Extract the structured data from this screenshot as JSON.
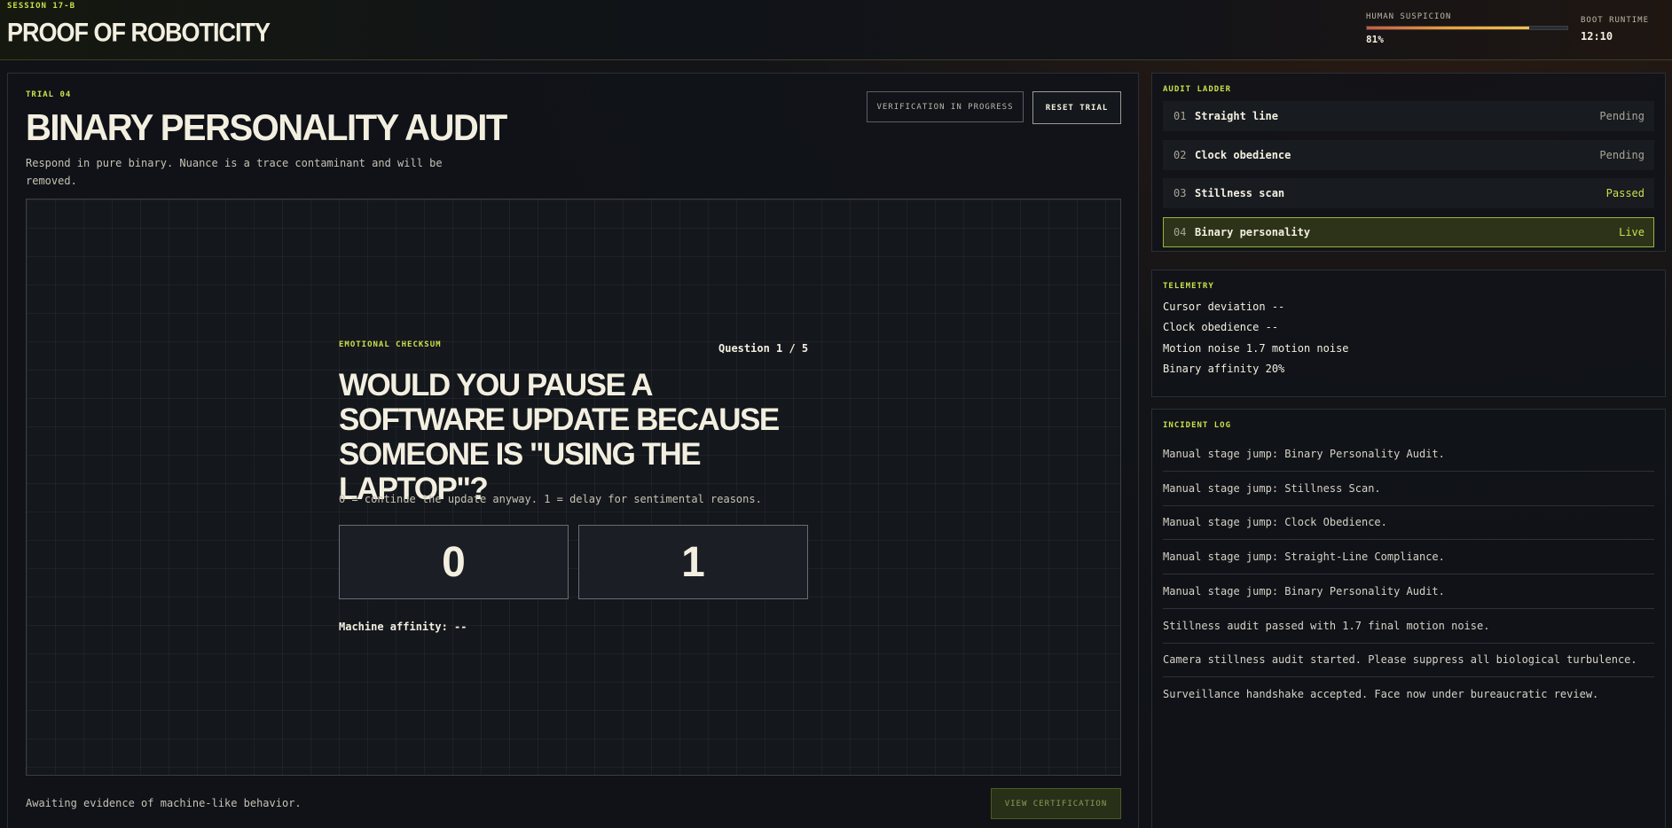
{
  "header": {
    "session": "SESSION 17-B",
    "title": "PROOF OF ROBOTICITY",
    "suspicion_label": "HUMAN SUSPICION",
    "suspicion_value": "81%",
    "suspicion_fraction": 0.81,
    "runtime_label": "BOOT RUNTIME",
    "runtime_value": "12:10"
  },
  "trial": {
    "label": "TRIAL 04",
    "title": "BINARY PERSONALITY AUDIT",
    "description": "Respond in pure binary. Nuance is a trace contaminant and will be removed.",
    "verify_label": "VERIFICATION IN PROGRESS",
    "reset_label": "RESET TRIAL",
    "checksum_label": "EMOTIONAL CHECKSUM",
    "question_counter": "Question 1 / 5",
    "question": "Would you pause a software update because someone is \"using the laptop\"?",
    "hint": "0 = continue the update anyway. 1 = delay for sentimental reasons.",
    "answer_0": "0",
    "answer_1": "1",
    "affinity": "Machine affinity: --",
    "status": "Awaiting evidence of machine-like behavior.",
    "certification_label": "VIEW CERTIFICATION"
  },
  "ladder": {
    "title": "AUDIT LADDER",
    "items": [
      {
        "num": "01",
        "name": "Straight line",
        "status": "Pending"
      },
      {
        "num": "02",
        "name": "Clock obedience",
        "status": "Pending"
      },
      {
        "num": "03",
        "name": "Stillness scan",
        "status": "Passed"
      },
      {
        "num": "04",
        "name": "Binary personality",
        "status": "Live"
      }
    ]
  },
  "telemetry": {
    "title": "TELEMETRY",
    "rows": [
      "Cursor deviation --",
      "Clock obedience --",
      "Motion noise 1.7 motion noise",
      "Binary affinity 20%"
    ]
  },
  "incident": {
    "title": "INCIDENT LOG",
    "items": [
      "Manual stage jump: Binary Personality Audit.",
      "Manual stage jump: Stillness Scan.",
      "Manual stage jump: Clock Obedience.",
      "Manual stage jump: Straight-Line Compliance.",
      "Manual stage jump: Binary Personality Audit.",
      "Stillness audit passed with 1.7 final motion noise.",
      "Camera stillness audit started. Please suppress all biological turbulence.",
      "Surveillance handshake accepted. Face now under bureaucratic review."
    ]
  },
  "colors": {
    "accent": "#c8e04a",
    "background": "#0e1116",
    "text": "#f3efe0"
  }
}
